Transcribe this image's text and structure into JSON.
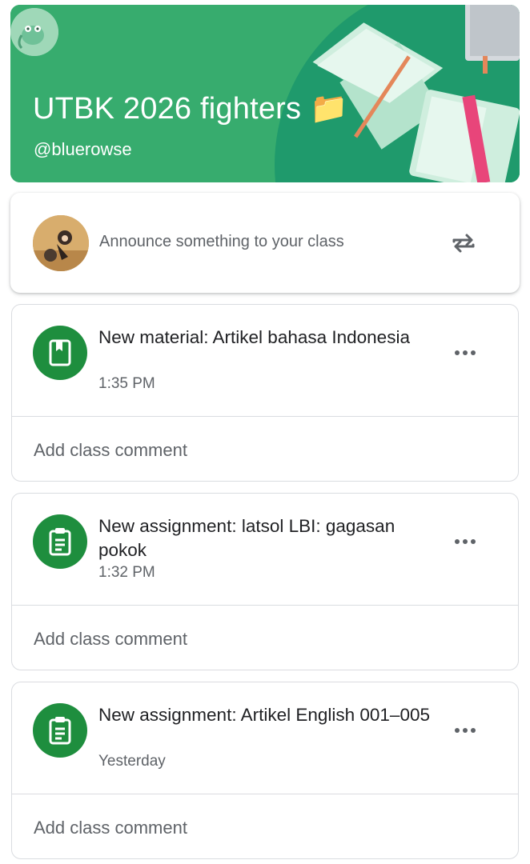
{
  "banner": {
    "title": "UTBK 2026 fighters 📁",
    "owner": "@bluerowse",
    "color": "#37ac6e"
  },
  "announce": {
    "placeholder": "Announce something to your class",
    "repost_icon": "repost-icon"
  },
  "stream": [
    {
      "type_icon": "material-book-icon",
      "title": "New material: Artikel bahasa Indonesia",
      "time": "1:35 PM",
      "comment_label": "Add class comment"
    },
    {
      "type_icon": "assignment-icon",
      "title": "New assignment: latsol LBI: gagasan pokok",
      "time": "1:32 PM",
      "comment_label": "Add class comment"
    },
    {
      "type_icon": "assignment-icon",
      "title": "New assignment: Artikel English 001–005",
      "time": "Yesterday",
      "comment_label": "Add class comment"
    }
  ],
  "colors": {
    "accent_green": "#1e8e3e",
    "text_secondary": "#5f6368",
    "border": "#dadce0"
  }
}
